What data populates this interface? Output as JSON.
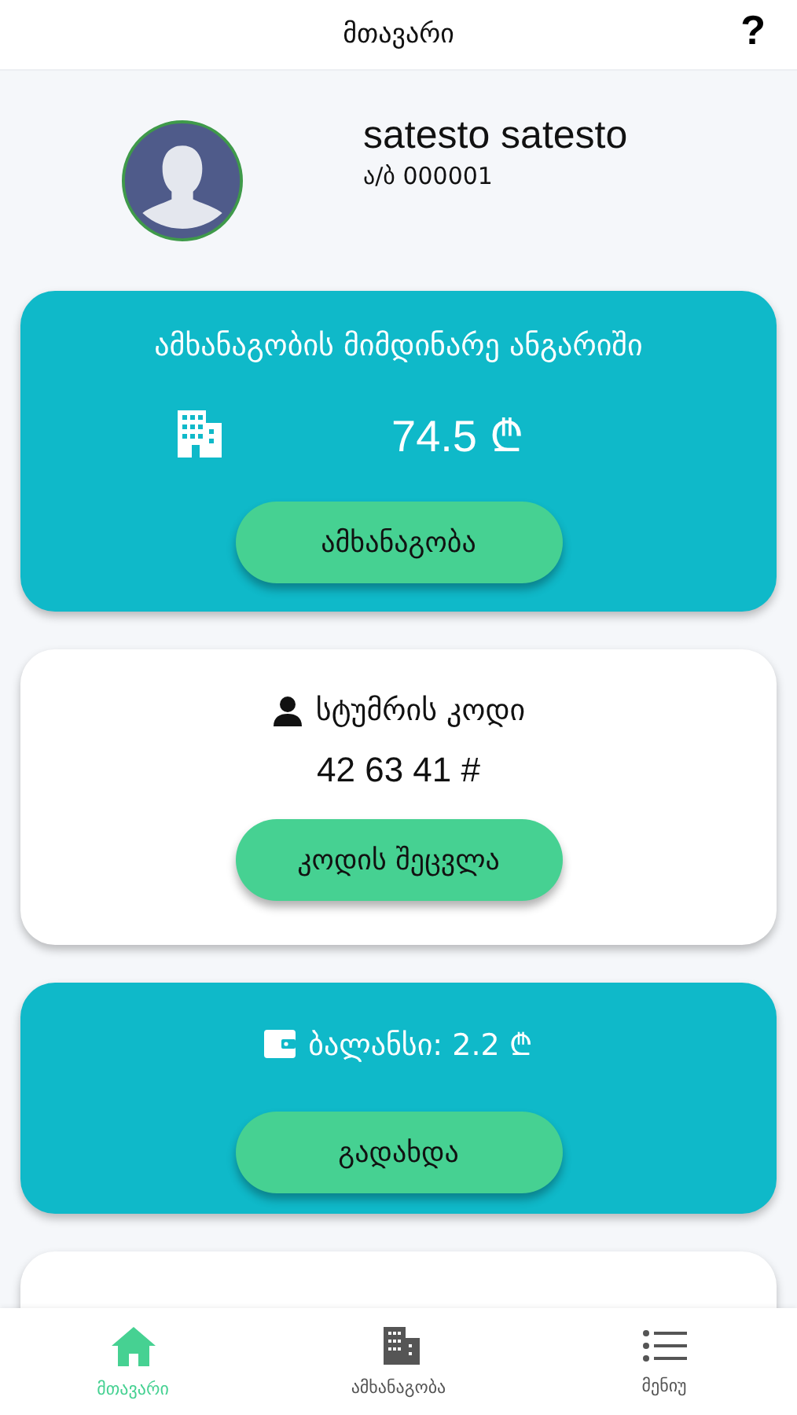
{
  "header": {
    "title": "მთავარი",
    "help": "?"
  },
  "profile": {
    "name": "satesto satesto",
    "id": "ა/ბ 000001"
  },
  "cards": [
    {
      "kind": "account",
      "title": "ამხანაგობის მიმდინარე ანგარიში",
      "amount": "74.5 ₾",
      "button": "ამხანაგობა"
    },
    {
      "kind": "code",
      "title": "სტუმრის კოდი",
      "code": "42 63 41 #",
      "button": "კოდის შეცვლა"
    },
    {
      "kind": "balance",
      "title": "ბალანსი: 2.2 ₾",
      "button": "გადახდა"
    },
    {
      "kind": "partial"
    }
  ],
  "tabs": [
    {
      "label": "მთავარი",
      "kind": "home",
      "selected": true
    },
    {
      "label": "ამხანაგობა",
      "kind": "building",
      "selected": false
    },
    {
      "label": "მენიუ",
      "kind": "menu",
      "selected": false
    }
  ]
}
